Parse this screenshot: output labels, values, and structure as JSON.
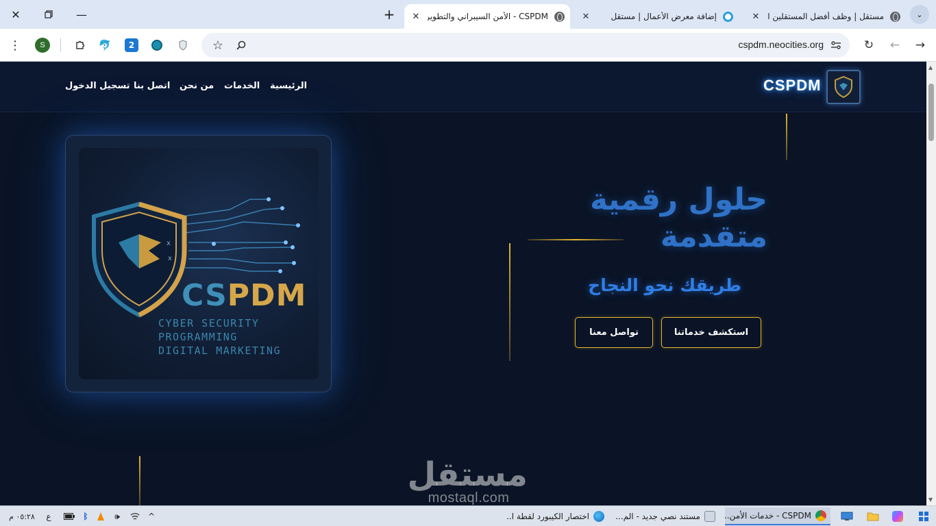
{
  "browser": {
    "tabs": [
      {
        "title": "مستقل | وظف أفضل المستقلين العرب",
        "icon": "globe-icon",
        "active": false
      },
      {
        "title": "إضافة معرض الأعمال | مستقل",
        "icon": "ring-icon",
        "active": false
      },
      {
        "title": "CSPDM - الأمن السيبراني والتطوير الرقمي",
        "icon": "globe-icon",
        "active": true
      }
    ],
    "new_tab_label": "+",
    "url": "cspdm.neocities.org",
    "profile_initial": "S",
    "extensions": [
      "puzzle-icon",
      "dolphin-icon",
      "two-icon",
      "globe-ext-icon",
      "shield-ext-icon"
    ]
  },
  "site": {
    "brand": "CSPDM",
    "nav": [
      "الرئيسية",
      "الخدمات",
      "من نحن",
      "اتصل بنا",
      "تسجيل الدخول"
    ],
    "hero": {
      "title_line1": "حلول رقمية",
      "title_line2": "متقدمة",
      "subtitle": "طريقك نحو النجاح",
      "primary_button": "استكشف خدماتنا",
      "secondary_button": "تواصل معنا"
    },
    "hero_image": {
      "brand_a": "CS",
      "brand_b": "PDM",
      "line1": "CYBER SECURITY",
      "line2": "PROGRAMMING",
      "line3": "DIGITAL MARKETING"
    },
    "watermark": {
      "ar": "مستقل",
      "en": "mostaql.com"
    },
    "colors": {
      "accent_gold": "#e8b531",
      "accent_blue": "#2f7ee6",
      "background": "#0a1426"
    }
  },
  "taskbar": {
    "items": [
      {
        "label": "CSPDM - خدمات الأمن...",
        "icon": "chrome-icon",
        "active": true
      },
      {
        "label": "مستند نصي جديد - الم...",
        "icon": "notepad-icon",
        "active": false
      },
      {
        "label": "اختصار الكيبورد لقطة ا...",
        "icon": "edge-icon",
        "active": false
      }
    ],
    "clock": "٠٥:٢٨ م",
    "input_language": "ع"
  }
}
